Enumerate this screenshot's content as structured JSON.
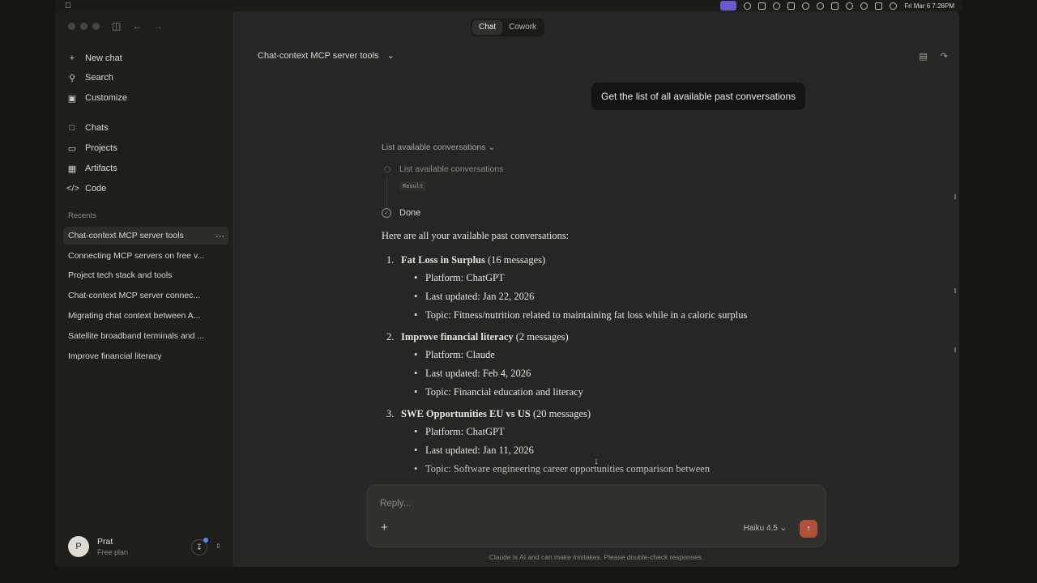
{
  "menubar": {
    "datetime": "Fri Mar 6  7:26PM"
  },
  "toggle": {
    "chat": "Chat",
    "cowork": "Cowork"
  },
  "sidebar": {
    "nav": [
      {
        "label": "New chat",
        "icon": "plus-icon"
      },
      {
        "label": "Search",
        "icon": "search-icon"
      },
      {
        "label": "Customize",
        "icon": "briefcase-icon"
      },
      {
        "label": "Chats",
        "icon": "chat-bubble-icon"
      },
      {
        "label": "Projects",
        "icon": "folder-icon"
      },
      {
        "label": "Artifacts",
        "icon": "grid-icon"
      },
      {
        "label": "Code",
        "icon": "code-icon"
      }
    ],
    "recents_label": "Recents",
    "recents": [
      "Chat-context MCP server tools",
      "Connecting MCP servers on free v...",
      "Project tech stack and tools",
      "Chat-context MCP server connec...",
      "Migrating chat context between A...",
      "Satellite broadband terminals and ...",
      "Improve financial literacy"
    ],
    "more": "⋯",
    "profile": {
      "initial": "P",
      "name": "Prat",
      "plan": "Free plan"
    }
  },
  "header": {
    "title": "Chat-context MCP server tools"
  },
  "user_message": "Get the list of all available past conversations",
  "tool": {
    "header": "List available conversations",
    "call_label": "List available conversations",
    "result_label": "Result",
    "done_label": "Done"
  },
  "answer": {
    "intro": "Here are all your available past conversations:",
    "conversations": [
      {
        "num": "1.",
        "title": "Fat Loss in Surplus",
        "count": " (16 messages)",
        "bullets": [
          "Platform: ChatGPT",
          "Last updated: Jan 22, 2026",
          "Topic: Fitness/nutrition related to maintaining fat loss while in a caloric surplus"
        ]
      },
      {
        "num": "2.",
        "title": "Improve financial literacy",
        "count": " (2 messages)",
        "bullets": [
          "Platform: Claude",
          "Last updated: Feb 4, 2026",
          "Topic: Financial education and literacy"
        ]
      },
      {
        "num": "3.",
        "title": "SWE Opportunities EU vs US",
        "count": " (20 messages)",
        "bullets": [
          "Platform: ChatGPT",
          "Last updated: Jan 11, 2026",
          "Topic: Software engineering career opportunities comparison between"
        ]
      }
    ]
  },
  "composer": {
    "placeholder": "Reply...",
    "model": "Haiku 4.5"
  },
  "disclaimer": "Claude is AI and can make mistakes. Please double-check responses."
}
